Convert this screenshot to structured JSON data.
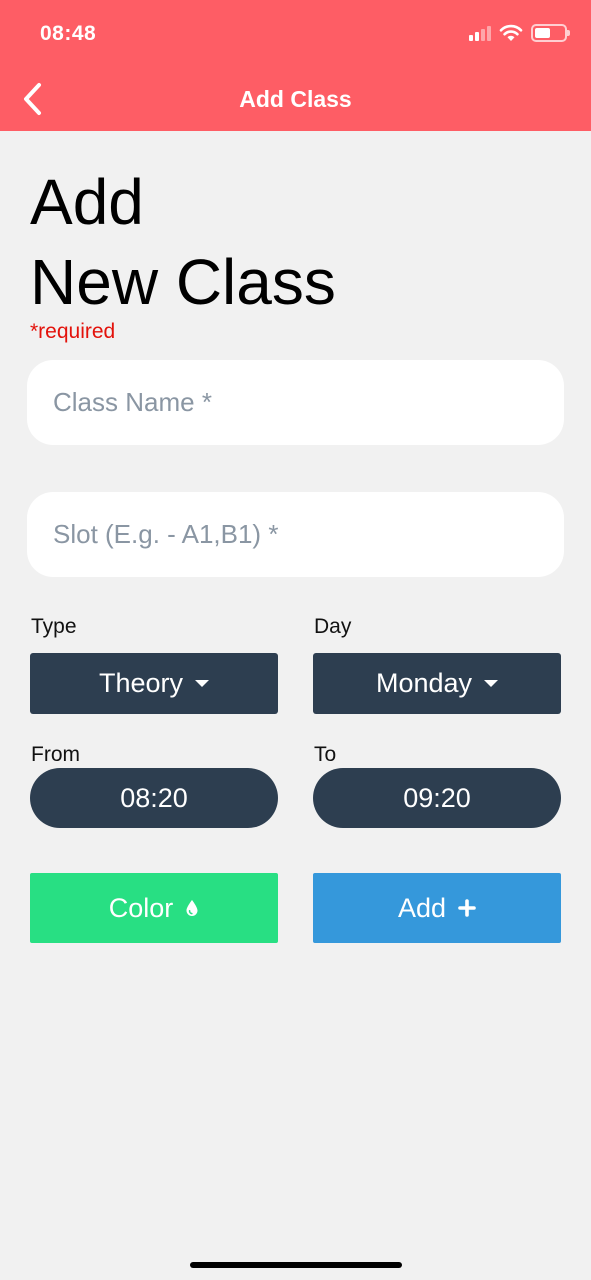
{
  "status_bar": {
    "time": "08:48"
  },
  "nav": {
    "title": "Add Class",
    "back_icon": "chevron-left-icon"
  },
  "page": {
    "title_line1": "Add",
    "title_line2": "New Class",
    "required_note": "*required"
  },
  "form": {
    "class_name": {
      "placeholder": "Class Name *",
      "value": ""
    },
    "slot": {
      "placeholder": "Slot (E.g. - A1,B1) *",
      "value": ""
    },
    "type": {
      "label": "Type",
      "selected": "Theory"
    },
    "day": {
      "label": "Day",
      "selected": "Monday"
    },
    "from": {
      "label": "From",
      "value": "08:20"
    },
    "to": {
      "label": "To",
      "value": "09:20"
    }
  },
  "actions": {
    "color_label": "Color",
    "color_icon": "drop-icon",
    "add_label": "Add",
    "add_icon": "plus-icon"
  },
  "colors": {
    "header": "#fe5d65",
    "dark_control": "#2d3e50",
    "color_button": "#28df83",
    "add_button": "#3598db",
    "required_text": "#e3120b"
  }
}
